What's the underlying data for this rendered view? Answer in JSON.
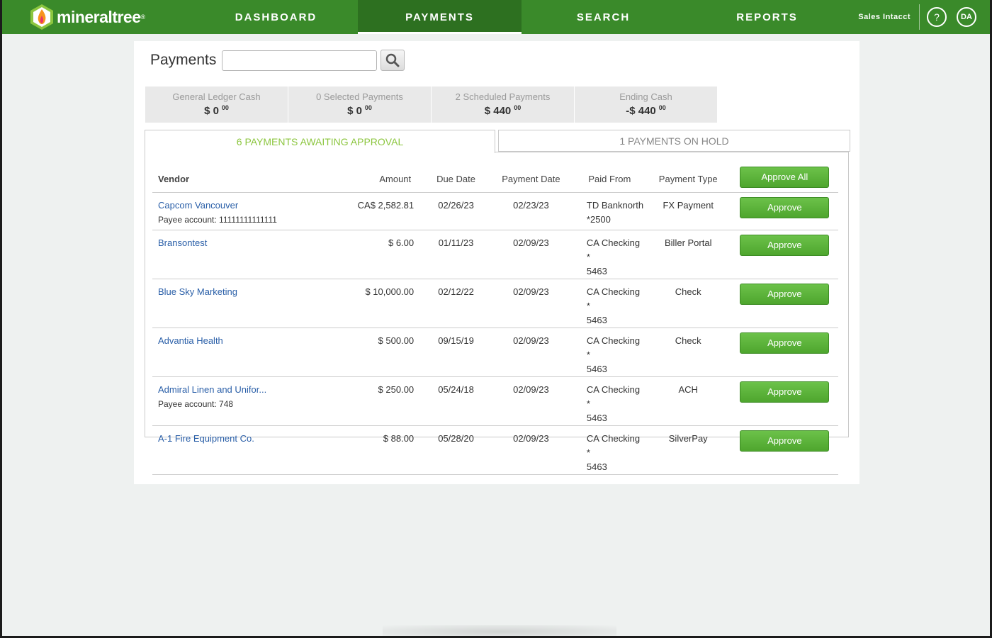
{
  "brand": {
    "name": "mineraltree",
    "reg": "®"
  },
  "nav": {
    "items": [
      {
        "label": "DASHBOARD",
        "active": false
      },
      {
        "label": "PAYMENTS",
        "active": true
      },
      {
        "label": "SEARCH",
        "active": false
      },
      {
        "label": "REPORTS",
        "active": false
      }
    ],
    "org": "Sales Intacct",
    "help": "?",
    "avatar": "DA"
  },
  "page": {
    "title": "Payments",
    "search_value": "",
    "search_icon": "search-icon"
  },
  "summary": [
    {
      "label": "General Ledger Cash",
      "value": "$ 0",
      "cents": "00"
    },
    {
      "label": "0 Selected Payments",
      "value": "$ 0",
      "cents": "00"
    },
    {
      "label": "2 Scheduled Payments",
      "value": "$ 440",
      "cents": "00"
    },
    {
      "label": "Ending Cash",
      "value": "-$ 440",
      "cents": "00"
    }
  ],
  "tabs": {
    "awaiting": "6 PAYMENTS AWAITING APPROVAL",
    "hold": "1 PAYMENTS ON HOLD"
  },
  "table": {
    "headers": {
      "vendor": "Vendor",
      "amount": "Amount",
      "due": "Due Date",
      "paydate": "Payment Date",
      "paidfrom": "Paid From",
      "type": "Payment Type",
      "approve_all": "Approve All"
    },
    "approve_label": "Approve",
    "rows": [
      {
        "vendor": "Capcom Vancouver",
        "payee": "Payee account: 11111111111111",
        "amount": "CA$ 2,582.81",
        "due": "02/26/23",
        "paydate": "02/23/23",
        "paidfrom1": "TD Banknorth",
        "paidfrom2": "*2500",
        "type": "FX Payment"
      },
      {
        "vendor": "Bransontest",
        "payee": "",
        "amount": "$ 6.00",
        "due": "01/11/23",
        "paydate": "02/09/23",
        "paidfrom1": "CA Checking *",
        "paidfrom2": "5463",
        "type": "Biller Portal"
      },
      {
        "vendor": "Blue Sky Marketing",
        "payee": "",
        "amount": "$ 10,000.00",
        "due": "02/12/22",
        "paydate": "02/09/23",
        "paidfrom1": "CA Checking *",
        "paidfrom2": "5463",
        "type": "Check"
      },
      {
        "vendor": "Advantia Health",
        "payee": "",
        "amount": "$ 500.00",
        "due": "09/15/19",
        "paydate": "02/09/23",
        "paidfrom1": "CA Checking *",
        "paidfrom2": "5463",
        "type": "Check"
      },
      {
        "vendor": "Admiral Linen and Unifor...",
        "payee": "Payee account: 748",
        "amount": "$ 250.00",
        "due": "05/24/18",
        "paydate": "02/09/23",
        "paidfrom1": "CA Checking *",
        "paidfrom2": "5463",
        "type": "ACH"
      },
      {
        "vendor": "A-1 Fire Equipment Co.",
        "payee": "",
        "amount": "$ 88.00",
        "due": "05/28/20",
        "paydate": "02/09/23",
        "paidfrom1": "CA Checking *",
        "paidfrom2": "5463",
        "type": "SilverPay"
      }
    ]
  },
  "colors": {
    "nav_green": "#3a8a2a",
    "nav_active": "#2d7020",
    "button_green": "#5bb53a",
    "tab_active_text": "#8cc63f",
    "link_blue": "#2a5fa8"
  }
}
